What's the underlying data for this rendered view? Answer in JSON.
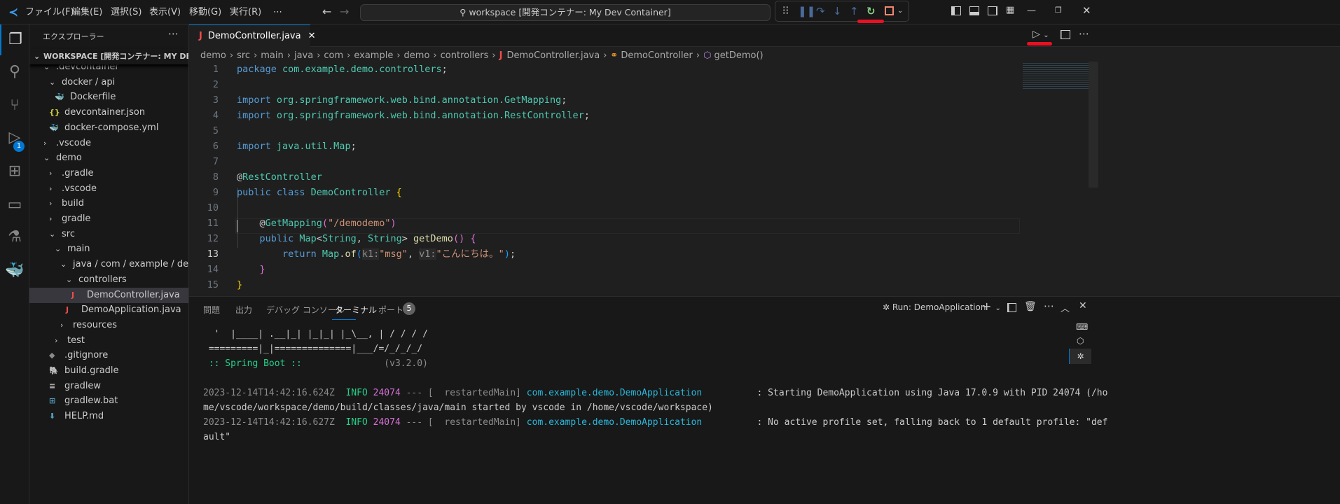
{
  "menu": [
    "ファイル(F)",
    "編集(E)",
    "選択(S)",
    "表示(V)",
    "移動(G)",
    "実行(R)",
    "⋯"
  ],
  "command_center": "workspace [開発コンテナー: My Dev Container]",
  "activity_badge": "1",
  "sidebar": {
    "title": "エクスプローラー",
    "workspace": "WORKSPACE [開発コンテナー: MY DEV CO...",
    "items": [
      {
        "label": ".devcontainer",
        "depth": 0,
        "kind": "folder-open"
      },
      {
        "label": "docker / api",
        "depth": 1,
        "kind": "folder-open"
      },
      {
        "label": "Dockerfile",
        "depth": 2,
        "kind": "docker"
      },
      {
        "label": "devcontainer.json",
        "depth": 1,
        "kind": "json"
      },
      {
        "label": "docker-compose.yml",
        "depth": 1,
        "kind": "yml"
      },
      {
        "label": ".vscode",
        "depth": 0,
        "kind": "folder"
      },
      {
        "label": "demo",
        "depth": 0,
        "kind": "folder-open"
      },
      {
        "label": ".gradle",
        "depth": 1,
        "kind": "folder"
      },
      {
        "label": ".vscode",
        "depth": 1,
        "kind": "folder"
      },
      {
        "label": "build",
        "depth": 1,
        "kind": "folder"
      },
      {
        "label": "gradle",
        "depth": 1,
        "kind": "folder"
      },
      {
        "label": "src",
        "depth": 1,
        "kind": "folder-open"
      },
      {
        "label": "main",
        "depth": 2,
        "kind": "folder-open"
      },
      {
        "label": "java / com / example / demo",
        "depth": 3,
        "kind": "folder-open"
      },
      {
        "label": "controllers",
        "depth": 4,
        "kind": "folder-open"
      },
      {
        "label": "DemoController.java",
        "depth": 5,
        "kind": "java",
        "selected": true
      },
      {
        "label": "DemoApplication.java",
        "depth": 4,
        "kind": "java"
      },
      {
        "label": "resources",
        "depth": 3,
        "kind": "folder"
      },
      {
        "label": "test",
        "depth": 2,
        "kind": "folder"
      },
      {
        "label": ".gitignore",
        "depth": 1,
        "kind": "git"
      },
      {
        "label": "build.gradle",
        "depth": 1,
        "kind": "gradle"
      },
      {
        "label": "gradlew",
        "depth": 1,
        "kind": "file"
      },
      {
        "label": "gradlew.bat",
        "depth": 1,
        "kind": "win"
      },
      {
        "label": "HELP.md",
        "depth": 1,
        "kind": "md"
      }
    ]
  },
  "editor": {
    "tab": "DemoController.java",
    "breadcrumb": [
      "demo",
      "src",
      "main",
      "java",
      "com",
      "example",
      "demo",
      "controllers",
      "DemoController.java",
      "DemoController",
      "getDemo()"
    ],
    "current_line": 13,
    "lines": [
      [
        [
          "kw",
          "package "
        ],
        [
          "pk",
          "com.example.demo.controllers"
        ],
        [
          "pl",
          ";"
        ]
      ],
      [],
      [
        [
          "kw",
          "import "
        ],
        [
          "pk",
          "org.springframework.web.bind.annotation.GetMapping"
        ],
        [
          "pl",
          ";"
        ]
      ],
      [
        [
          "kw",
          "import "
        ],
        [
          "pk",
          "org.springframework.web.bind.annotation.RestController"
        ],
        [
          "pl",
          ";"
        ]
      ],
      [],
      [
        [
          "kw",
          "import "
        ],
        [
          "pk",
          "java.util.Map"
        ],
        [
          "pl",
          ";"
        ]
      ],
      [],
      [
        [
          "pl",
          "@"
        ],
        [
          "ty",
          "RestController"
        ]
      ],
      [
        [
          "kw",
          "public class "
        ],
        [
          "ty",
          "DemoController "
        ],
        [
          "br",
          "{"
        ]
      ],
      [],
      [
        [
          "pl",
          "    @"
        ],
        [
          "ty",
          "GetMapping"
        ],
        [
          "br2",
          "("
        ],
        [
          "st",
          "\"/demodemo\""
        ],
        [
          "br2",
          ")"
        ]
      ],
      [
        [
          "kw",
          "    public "
        ],
        [
          "ty",
          "Map"
        ],
        [
          "pl",
          "<"
        ],
        [
          "ty",
          "String"
        ],
        [
          "pl",
          ", "
        ],
        [
          "ty",
          "String"
        ],
        [
          "pl",
          "> "
        ],
        [
          "fn",
          "getDemo"
        ],
        [
          "br2",
          "()"
        ],
        [
          "pl",
          " "
        ],
        [
          "br2",
          "{"
        ]
      ],
      [
        [
          "kw",
          "        return "
        ],
        [
          "ty",
          "Map"
        ],
        [
          "pl",
          "."
        ],
        [
          "fn",
          "of"
        ],
        [
          "br3",
          "("
        ],
        [
          "hint",
          "k1:"
        ],
        [
          "st",
          "\"msg\""
        ],
        [
          "pl",
          ", "
        ],
        [
          "hint",
          "v1:"
        ],
        [
          "st",
          "\"こんにちは。\""
        ],
        [
          "br3",
          ")"
        ],
        [
          "pl",
          ";"
        ]
      ],
      [
        [
          "br2",
          "    }"
        ]
      ],
      [
        [
          "br",
          "}"
        ]
      ],
      []
    ]
  },
  "panel": {
    "tabs": [
      "問題",
      "出力",
      "デバッグ コンソール",
      "ターミナル",
      "ポート"
    ],
    "ports_badge": "5",
    "active_tab": "ターミナル",
    "terminal_name": "Run: DemoApplication",
    "terminal": [
      [
        [
          "pl",
          "  '  |____| .__|_| |_|_| |_\\__, | / / / /"
        ]
      ],
      [
        [
          "pl",
          " =========|_|==============|___/=/_/_/_/"
        ]
      ],
      [
        [
          "grn",
          " :: Spring Boot :: "
        ],
        [
          "gray",
          "              (v3.2.0)"
        ]
      ],
      [],
      [
        [
          "gray",
          "2023-12-14T14:42:16.624Z  "
        ],
        [
          "grn",
          "INFO "
        ],
        [
          "mag",
          "24074"
        ],
        [
          "gray",
          " --- [  restartedMain] "
        ],
        [
          "cy",
          "com.example.demo.DemoApplication        "
        ],
        [
          "pl",
          "  : Starting DemoApplication using Java 17.0.9 with PID 24074 (/ho"
        ]
      ],
      [
        [
          "pl",
          "me/vscode/workspace/demo/build/classes/java/main started by vscode in /home/vscode/workspace)"
        ]
      ],
      [
        [
          "gray",
          "2023-12-14T14:42:16.627Z  "
        ],
        [
          "grn",
          "INFO "
        ],
        [
          "mag",
          "24074"
        ],
        [
          "gray",
          " --- [  restartedMain] "
        ],
        [
          "cy",
          "com.example.demo.DemoApplication        "
        ],
        [
          "pl",
          "  : No active profile set, falling back to 1 default profile: \"def"
        ]
      ],
      [
        [
          "pl",
          "ault\""
        ]
      ]
    ]
  }
}
